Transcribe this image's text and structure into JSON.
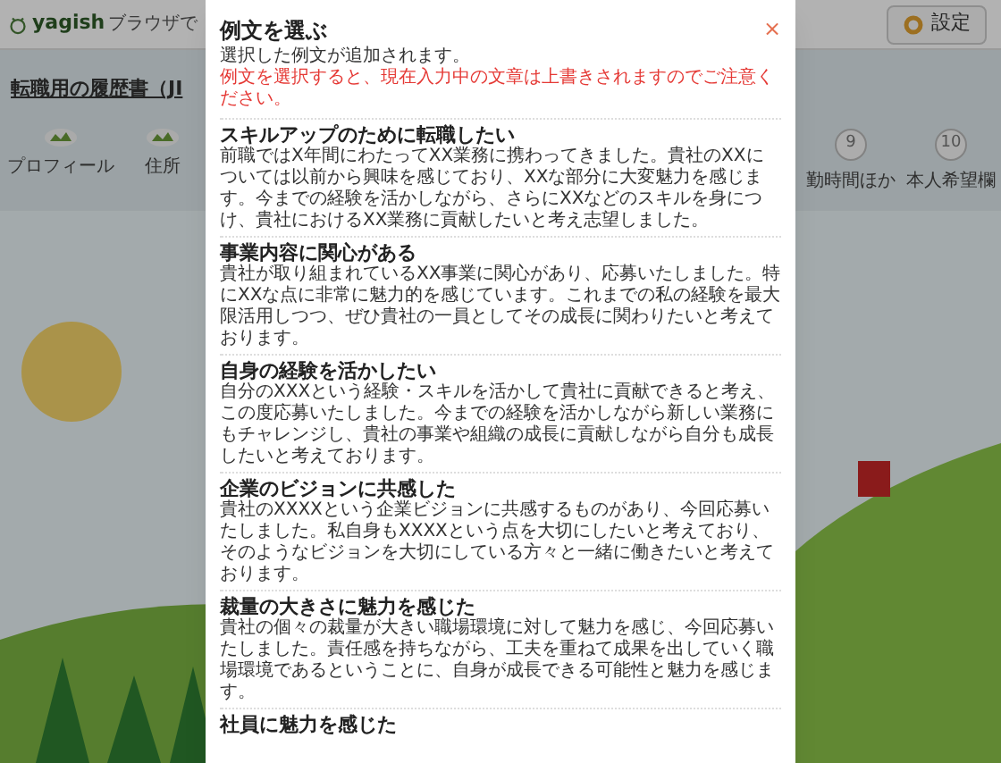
{
  "header": {
    "logo": "yagish",
    "tagline": "ブラウザで",
    "settings_button": "設定"
  },
  "page_title": "転職用の履歴書（JI",
  "steps_left": [
    {
      "label": "プロフィール"
    },
    {
      "label": "住所"
    }
  ],
  "steps_right": [
    {
      "number": "9",
      "label": "勤時間ほか"
    },
    {
      "number": "10",
      "label": "本人希望欄"
    }
  ],
  "modal": {
    "close": "×",
    "title": "例文を選ぶ",
    "note": "選択した例文が追加されます。",
    "warning": "例文を選択すると、現在入力中の文章は上書きされますのでご注意ください。",
    "examples": [
      {
        "title": "スキルアップのために転職したい",
        "body": "前職ではX年間にわたってXX業務に携わってきました。貴社のXXについては以前から興味を感じており、XXな部分に大変魅力を感じます。今までの経験を活かしながら、さらにXXなどのスキルを身につけ、貴社におけるXX業務に貢献したいと考え志望しました。"
      },
      {
        "title": "事業内容に関心がある",
        "body": "貴社が取り組まれているXX事業に関心があり、応募いたしました。特にXXな点に非常に魅力的を感じています。これまでの私の経験を最大限活用しつつ、ぜひ貴社の一員としてその成長に関わりたいと考えております。"
      },
      {
        "title": "自身の経験を活かしたい",
        "body": "自分のXXXという経験・スキルを活かして貴社に貢献できると考え、この度応募いたしました。今までの経験を活かしながら新しい業務にもチャレンジし、貴社の事業や組織の成長に貢献しながら自分も成長したいと考えております。"
      },
      {
        "title": "企業のビジョンに共感した",
        "body": "貴社のXXXXという企業ビジョンに共感するものがあり、今回応募いたしました。私自身もXXXXという点を大切にしたいと考えており、そのようなビジョンを大切にしている方々と一緒に働きたいと考えております。"
      },
      {
        "title": "裁量の大きさに魅力を感じた",
        "body": "貴社の個々の裁量が大きい職場環境に対して魅力を感じ、今回応募いたしました。責任感を持ちながら、工夫を重ねて成果を出していく職場環境であるということに、自身が成長できる可能性と魅力を感じます。"
      },
      {
        "title": "社員に魅力を感じた"
      }
    ]
  }
}
